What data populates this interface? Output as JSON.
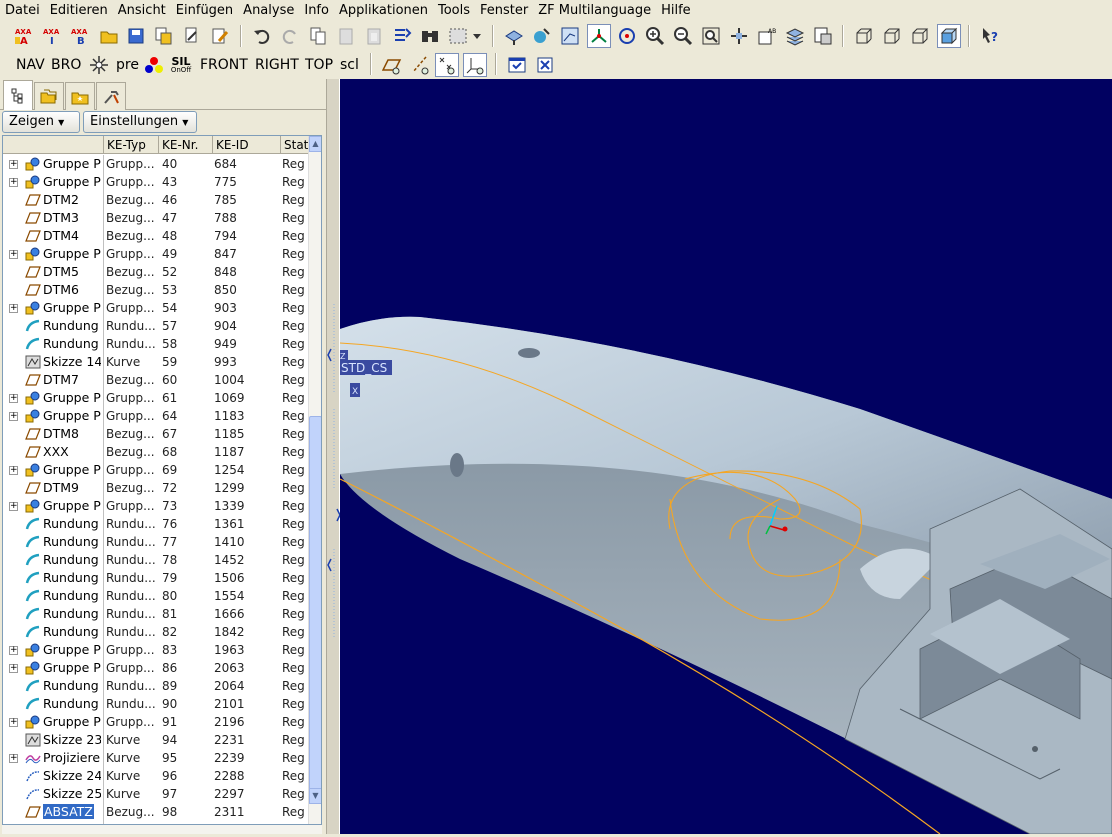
{
  "menu": [
    "Datei",
    "Editieren",
    "Ansicht",
    "Einfügen",
    "Analyse",
    "Info",
    "Applikationen",
    "Tools",
    "Fenster",
    "ZF Multilanguage",
    "Hilfe"
  ],
  "toolbar2_text": {
    "nav": "NAV",
    "bro": "BRO",
    "pre": "pre",
    "front": "FRONT",
    "right": "RIGHT",
    "top": "TOP",
    "scl": "scl",
    "sil": "SIL",
    "sil_sub": "OnOff"
  },
  "axa_labels": {
    "a1": "AXA",
    "a2": "AXA",
    "a3": "AXA",
    "s1": "A",
    "s2": "I",
    "s3": "B"
  },
  "panel": {
    "zeigen": "Zeigen",
    "einstellungen": "Einstellungen"
  },
  "columns": [
    "KE-Typ",
    "KE-Nr.",
    "KE-ID",
    "Status"
  ],
  "rows": [
    {
      "expand": true,
      "icon": "group",
      "name": "Gruppe P",
      "typ": "Grupp...",
      "nr": "40",
      "id": "684",
      "status": "Reg"
    },
    {
      "expand": true,
      "icon": "group",
      "name": "Gruppe P",
      "typ": "Grupp...",
      "nr": "43",
      "id": "775",
      "status": "Reg"
    },
    {
      "expand": false,
      "icon": "plane",
      "name": "DTM2",
      "typ": "Bezug...",
      "nr": "46",
      "id": "785",
      "status": "Reg"
    },
    {
      "expand": false,
      "icon": "plane",
      "name": "DTM3",
      "typ": "Bezug...",
      "nr": "47",
      "id": "788",
      "status": "Reg"
    },
    {
      "expand": false,
      "icon": "plane",
      "name": "DTM4",
      "typ": "Bezug...",
      "nr": "48",
      "id": "794",
      "status": "Reg"
    },
    {
      "expand": true,
      "icon": "group",
      "name": "Gruppe P",
      "typ": "Grupp...",
      "nr": "49",
      "id": "847",
      "status": "Reg"
    },
    {
      "expand": false,
      "icon": "plane",
      "name": "DTM5",
      "typ": "Bezug...",
      "nr": "52",
      "id": "848",
      "status": "Reg"
    },
    {
      "expand": false,
      "icon": "plane",
      "name": "DTM6",
      "typ": "Bezug...",
      "nr": "53",
      "id": "850",
      "status": "Reg"
    },
    {
      "expand": true,
      "icon": "group",
      "name": "Gruppe P",
      "typ": "Grupp...",
      "nr": "54",
      "id": "903",
      "status": "Reg"
    },
    {
      "expand": false,
      "icon": "round",
      "name": "Rundung",
      "typ": "Rundu...",
      "nr": "57",
      "id": "904",
      "status": "Reg"
    },
    {
      "expand": false,
      "icon": "round",
      "name": "Rundung",
      "typ": "Rundu...",
      "nr": "58",
      "id": "949",
      "status": "Reg"
    },
    {
      "expand": false,
      "icon": "sketch",
      "name": "Skizze 14",
      "typ": "Kurve",
      "nr": "59",
      "id": "993",
      "status": "Reg"
    },
    {
      "expand": false,
      "icon": "plane",
      "name": "DTM7",
      "typ": "Bezug...",
      "nr": "60",
      "id": "1004",
      "status": "Reg"
    },
    {
      "expand": true,
      "icon": "group",
      "name": "Gruppe P",
      "typ": "Grupp...",
      "nr": "61",
      "id": "1069",
      "status": "Reg"
    },
    {
      "expand": true,
      "icon": "group",
      "name": "Gruppe P",
      "typ": "Grupp...",
      "nr": "64",
      "id": "1183",
      "status": "Reg"
    },
    {
      "expand": false,
      "icon": "plane",
      "name": "DTM8",
      "typ": "Bezug...",
      "nr": "67",
      "id": "1185",
      "status": "Reg"
    },
    {
      "expand": false,
      "icon": "plane",
      "name": "XXX",
      "typ": "Bezug...",
      "nr": "68",
      "id": "1187",
      "status": "Reg"
    },
    {
      "expand": true,
      "icon": "group",
      "name": "Gruppe P",
      "typ": "Grupp...",
      "nr": "69",
      "id": "1254",
      "status": "Reg"
    },
    {
      "expand": false,
      "icon": "plane",
      "name": "DTM9",
      "typ": "Bezug...",
      "nr": "72",
      "id": "1299",
      "status": "Reg"
    },
    {
      "expand": true,
      "icon": "group",
      "name": "Gruppe P",
      "typ": "Grupp...",
      "nr": "73",
      "id": "1339",
      "status": "Reg"
    },
    {
      "expand": false,
      "icon": "round",
      "name": "Rundung",
      "typ": "Rundu...",
      "nr": "76",
      "id": "1361",
      "status": "Reg"
    },
    {
      "expand": false,
      "icon": "round",
      "name": "Rundung",
      "typ": "Rundu...",
      "nr": "77",
      "id": "1410",
      "status": "Reg"
    },
    {
      "expand": false,
      "icon": "round",
      "name": "Rundung",
      "typ": "Rundu...",
      "nr": "78",
      "id": "1452",
      "status": "Reg"
    },
    {
      "expand": false,
      "icon": "round",
      "name": "Rundung",
      "typ": "Rundu...",
      "nr": "79",
      "id": "1506",
      "status": "Reg"
    },
    {
      "expand": false,
      "icon": "round",
      "name": "Rundung",
      "typ": "Rundu...",
      "nr": "80",
      "id": "1554",
      "status": "Reg"
    },
    {
      "expand": false,
      "icon": "round",
      "name": "Rundung",
      "typ": "Rundu...",
      "nr": "81",
      "id": "1666",
      "status": "Reg"
    },
    {
      "expand": false,
      "icon": "round",
      "name": "Rundung",
      "typ": "Rundu...",
      "nr": "82",
      "id": "1842",
      "status": "Reg"
    },
    {
      "expand": true,
      "icon": "group",
      "name": "Gruppe P",
      "typ": "Grupp...",
      "nr": "83",
      "id": "1963",
      "status": "Reg"
    },
    {
      "expand": true,
      "icon": "group",
      "name": "Gruppe P",
      "typ": "Grupp...",
      "nr": "86",
      "id": "2063",
      "status": "Reg"
    },
    {
      "expand": false,
      "icon": "round",
      "name": "Rundung",
      "typ": "Rundu...",
      "nr": "89",
      "id": "2064",
      "status": "Reg"
    },
    {
      "expand": false,
      "icon": "round",
      "name": "Rundung",
      "typ": "Rundu...",
      "nr": "90",
      "id": "2101",
      "status": "Reg"
    },
    {
      "expand": true,
      "icon": "group",
      "name": "Gruppe P",
      "typ": "Grupp...",
      "nr": "91",
      "id": "2196",
      "status": "Reg"
    },
    {
      "expand": false,
      "icon": "sketch",
      "name": "Skizze 23",
      "typ": "Kurve",
      "nr": "94",
      "id": "2231",
      "status": "Reg"
    },
    {
      "expand": true,
      "icon": "project",
      "name": "Projiziere",
      "typ": "Kurve",
      "nr": "95",
      "id": "2239",
      "status": "Reg"
    },
    {
      "expand": false,
      "icon": "sketch2",
      "name": "Skizze 24",
      "typ": "Kurve",
      "nr": "96",
      "id": "2288",
      "status": "Reg"
    },
    {
      "expand": false,
      "icon": "sketch2",
      "name": "Skizze 25",
      "typ": "Kurve",
      "nr": "97",
      "id": "2297",
      "status": "Reg"
    },
    {
      "expand": false,
      "icon": "plane",
      "name": "ABSATZ",
      "typ": "Bezug...",
      "nr": "98",
      "id": "2311",
      "status": "Reg",
      "selected": true
    }
  ],
  "viewport": {
    "csys_label": "STD_CS",
    "csys_x": "X",
    "csys_z": "Z"
  },
  "colors": {
    "viewport_bg": "#010161",
    "part": "#b4c4d2",
    "curve": "#f5a623",
    "select": "#316ac5"
  }
}
